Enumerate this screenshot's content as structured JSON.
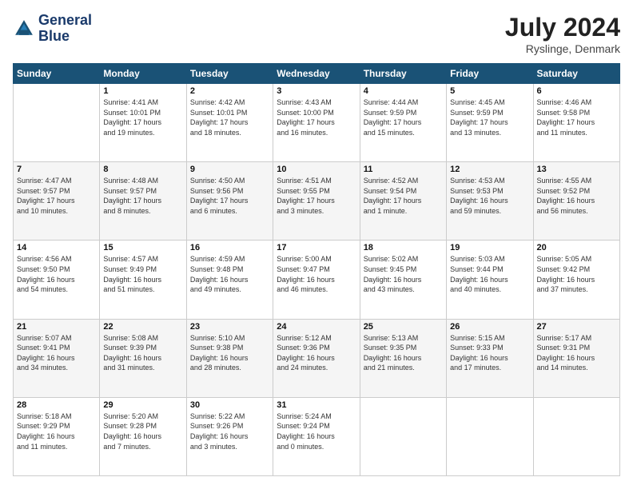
{
  "header": {
    "logo_line1": "General",
    "logo_line2": "Blue",
    "month_title": "July 2024",
    "location": "Ryslinge, Denmark"
  },
  "weekdays": [
    "Sunday",
    "Monday",
    "Tuesday",
    "Wednesday",
    "Thursday",
    "Friday",
    "Saturday"
  ],
  "weeks": [
    [
      {
        "day": "",
        "info": ""
      },
      {
        "day": "1",
        "info": "Sunrise: 4:41 AM\nSunset: 10:01 PM\nDaylight: 17 hours\nand 19 minutes."
      },
      {
        "day": "2",
        "info": "Sunrise: 4:42 AM\nSunset: 10:01 PM\nDaylight: 17 hours\nand 18 minutes."
      },
      {
        "day": "3",
        "info": "Sunrise: 4:43 AM\nSunset: 10:00 PM\nDaylight: 17 hours\nand 16 minutes."
      },
      {
        "day": "4",
        "info": "Sunrise: 4:44 AM\nSunset: 9:59 PM\nDaylight: 17 hours\nand 15 minutes."
      },
      {
        "day": "5",
        "info": "Sunrise: 4:45 AM\nSunset: 9:59 PM\nDaylight: 17 hours\nand 13 minutes."
      },
      {
        "day": "6",
        "info": "Sunrise: 4:46 AM\nSunset: 9:58 PM\nDaylight: 17 hours\nand 11 minutes."
      }
    ],
    [
      {
        "day": "7",
        "info": "Sunrise: 4:47 AM\nSunset: 9:57 PM\nDaylight: 17 hours\nand 10 minutes."
      },
      {
        "day": "8",
        "info": "Sunrise: 4:48 AM\nSunset: 9:57 PM\nDaylight: 17 hours\nand 8 minutes."
      },
      {
        "day": "9",
        "info": "Sunrise: 4:50 AM\nSunset: 9:56 PM\nDaylight: 17 hours\nand 6 minutes."
      },
      {
        "day": "10",
        "info": "Sunrise: 4:51 AM\nSunset: 9:55 PM\nDaylight: 17 hours\nand 3 minutes."
      },
      {
        "day": "11",
        "info": "Sunrise: 4:52 AM\nSunset: 9:54 PM\nDaylight: 17 hours\nand 1 minute."
      },
      {
        "day": "12",
        "info": "Sunrise: 4:53 AM\nSunset: 9:53 PM\nDaylight: 16 hours\nand 59 minutes."
      },
      {
        "day": "13",
        "info": "Sunrise: 4:55 AM\nSunset: 9:52 PM\nDaylight: 16 hours\nand 56 minutes."
      }
    ],
    [
      {
        "day": "14",
        "info": "Sunrise: 4:56 AM\nSunset: 9:50 PM\nDaylight: 16 hours\nand 54 minutes."
      },
      {
        "day": "15",
        "info": "Sunrise: 4:57 AM\nSunset: 9:49 PM\nDaylight: 16 hours\nand 51 minutes."
      },
      {
        "day": "16",
        "info": "Sunrise: 4:59 AM\nSunset: 9:48 PM\nDaylight: 16 hours\nand 49 minutes."
      },
      {
        "day": "17",
        "info": "Sunrise: 5:00 AM\nSunset: 9:47 PM\nDaylight: 16 hours\nand 46 minutes."
      },
      {
        "day": "18",
        "info": "Sunrise: 5:02 AM\nSunset: 9:45 PM\nDaylight: 16 hours\nand 43 minutes."
      },
      {
        "day": "19",
        "info": "Sunrise: 5:03 AM\nSunset: 9:44 PM\nDaylight: 16 hours\nand 40 minutes."
      },
      {
        "day": "20",
        "info": "Sunrise: 5:05 AM\nSunset: 9:42 PM\nDaylight: 16 hours\nand 37 minutes."
      }
    ],
    [
      {
        "day": "21",
        "info": "Sunrise: 5:07 AM\nSunset: 9:41 PM\nDaylight: 16 hours\nand 34 minutes."
      },
      {
        "day": "22",
        "info": "Sunrise: 5:08 AM\nSunset: 9:39 PM\nDaylight: 16 hours\nand 31 minutes."
      },
      {
        "day": "23",
        "info": "Sunrise: 5:10 AM\nSunset: 9:38 PM\nDaylight: 16 hours\nand 28 minutes."
      },
      {
        "day": "24",
        "info": "Sunrise: 5:12 AM\nSunset: 9:36 PM\nDaylight: 16 hours\nand 24 minutes."
      },
      {
        "day": "25",
        "info": "Sunrise: 5:13 AM\nSunset: 9:35 PM\nDaylight: 16 hours\nand 21 minutes."
      },
      {
        "day": "26",
        "info": "Sunrise: 5:15 AM\nSunset: 9:33 PM\nDaylight: 16 hours\nand 17 minutes."
      },
      {
        "day": "27",
        "info": "Sunrise: 5:17 AM\nSunset: 9:31 PM\nDaylight: 16 hours\nand 14 minutes."
      }
    ],
    [
      {
        "day": "28",
        "info": "Sunrise: 5:18 AM\nSunset: 9:29 PM\nDaylight: 16 hours\nand 11 minutes."
      },
      {
        "day": "29",
        "info": "Sunrise: 5:20 AM\nSunset: 9:28 PM\nDaylight: 16 hours\nand 7 minutes."
      },
      {
        "day": "30",
        "info": "Sunrise: 5:22 AM\nSunset: 9:26 PM\nDaylight: 16 hours\nand 3 minutes."
      },
      {
        "day": "31",
        "info": "Sunrise: 5:24 AM\nSunset: 9:24 PM\nDaylight: 16 hours\nand 0 minutes."
      },
      {
        "day": "",
        "info": ""
      },
      {
        "day": "",
        "info": ""
      },
      {
        "day": "",
        "info": ""
      }
    ]
  ]
}
